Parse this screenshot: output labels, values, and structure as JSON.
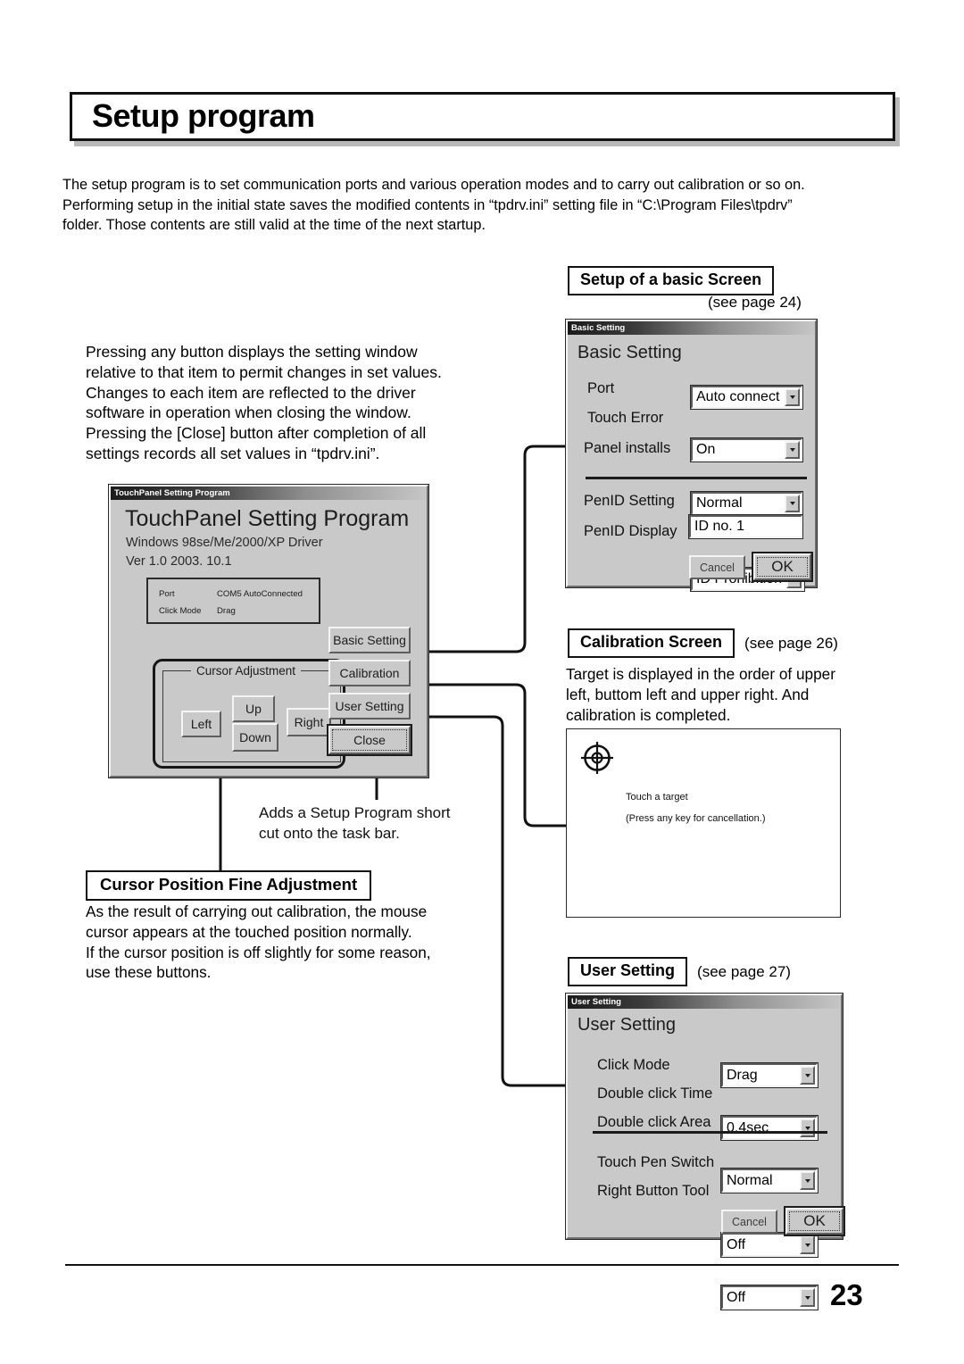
{
  "page": {
    "title": "Setup program",
    "number": "23",
    "intro": [
      "The setup program is to set communication ports and various operation modes and to carry out calibration or so on.",
      "Performing setup in the initial state saves the modified contents in “tpdrv.ini” setting file in “C:\\Program Files\\tpdrv”",
      "folder. Those contents are still valid at the time of the next startup."
    ]
  },
  "left_description": [
    "Pressing any button displays the setting window",
    "relative to that item to permit changes in set values.",
    "Changes to each item are reflected to the driver",
    "software in operation when closing the window.",
    "Pressing the [Close] button after completion of all",
    "settings records all set values in “tpdrv.ini”."
  ],
  "touchpanel_dialog": {
    "titlebar": "TouchPanel Setting Program",
    "heading": "TouchPanel Setting Program",
    "subtitle1": "Windows 98se/Me/2000/XP Driver",
    "subtitle2": "Ver 1.0 2003. 10.1",
    "info": [
      {
        "label": "Port",
        "value": "COM5 AutoConnected"
      },
      {
        "label": "Click Mode",
        "value": "Drag"
      }
    ],
    "cursor_group_legend": "Cursor Adjustment",
    "cursor_buttons": {
      "up": "Up",
      "down": "Down",
      "left": "Left",
      "right": "Right"
    },
    "side_buttons": [
      "Basic Setting",
      "Calibration",
      "User Setting",
      "Close"
    ]
  },
  "basic_section": {
    "heading": "Setup of a basic Screen",
    "see_page": "(see page 24)",
    "dialog": {
      "titlebar": "Basic Setting",
      "heading": "Basic Setting",
      "fields": [
        {
          "label": "Port",
          "value": "Auto connect",
          "type": "combo"
        },
        {
          "label": "Touch Error",
          "value": "On",
          "type": "combo"
        },
        {
          "label": "Panel installs",
          "value": "Normal",
          "type": "combo"
        },
        {
          "label": "PenID Setting",
          "value": "ID Prohibition",
          "type": "combo"
        },
        {
          "label": "PenID Display",
          "value": "ID no. 1",
          "type": "text"
        }
      ],
      "buttons": {
        "cancel": "Cancel",
        "ok": "OK"
      }
    }
  },
  "calibration_section": {
    "heading": "Calibration Screen",
    "see_page": "(see page 26)",
    "description": [
      "Target is displayed in the order of upper",
      "left, buttom left and upper right. And",
      "calibration is completed."
    ],
    "preview": {
      "line1": "Touch a target",
      "line2": "(Press any key for cancellation.)"
    }
  },
  "user_section": {
    "heading": "User Setting",
    "see_page": "(see page 27)",
    "dialog": {
      "titlebar": "User Setting",
      "heading": "User Setting",
      "fields": [
        {
          "label": "Click Mode",
          "value": "Drag"
        },
        {
          "label": "Double click Time",
          "value": "0.4sec"
        },
        {
          "label": "Double click Area",
          "value": "Normal"
        },
        {
          "label": "Touch Pen Switch",
          "value": "Off"
        },
        {
          "label": "Right Button Tool",
          "value": "Off"
        }
      ],
      "buttons": {
        "cancel": "Cancel",
        "ok": "OK"
      }
    }
  },
  "notes": {
    "adds_shortcut": [
      "Adds a Setup Program short",
      "cut onto the task bar."
    ],
    "cursor_fine_heading": "Cursor Position Fine Adjustment",
    "cursor_fine_text": [
      "As the result of carrying out calibration, the mouse",
      "cursor appears at the touched position normally.",
      "If the cursor position is off slightly for some reason,",
      "use these buttons."
    ]
  },
  "colors": {
    "dialog_face": "#c9c9c9",
    "ink": "#111111",
    "page_bg": "#ffffff"
  }
}
